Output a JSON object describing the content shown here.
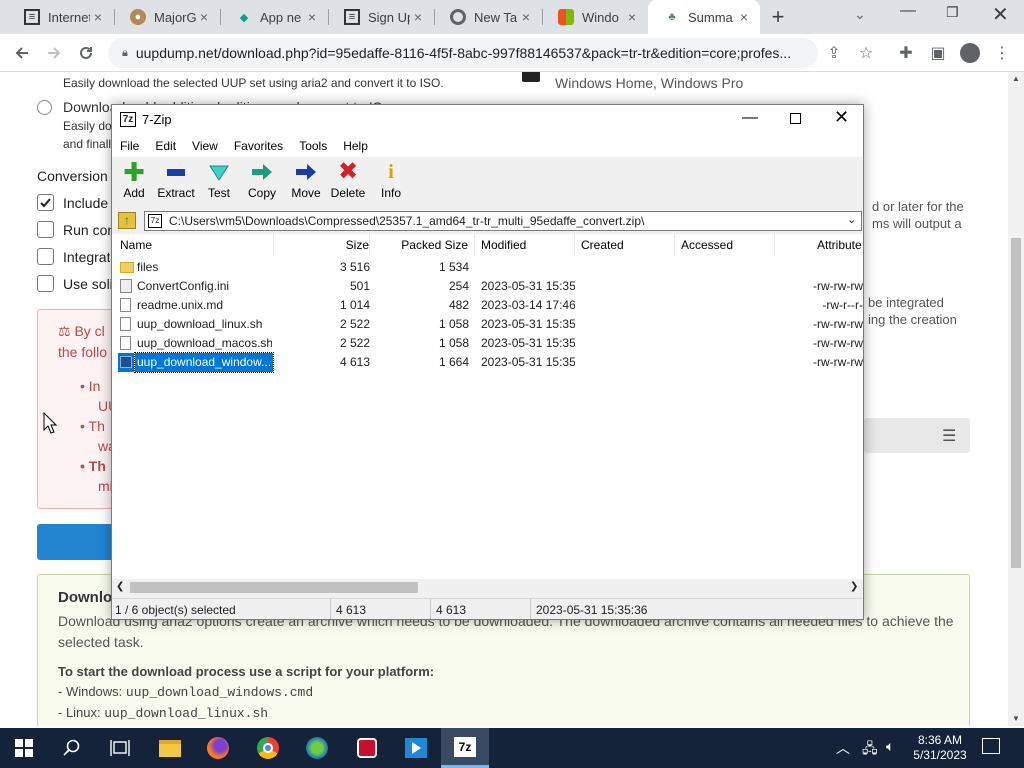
{
  "browser": {
    "tabs": [
      {
        "label": "Internet"
      },
      {
        "label": "MajorGe"
      },
      {
        "label": "App ne"
      },
      {
        "label": "Sign Up"
      },
      {
        "label": "New Tab"
      },
      {
        "label": "Windo"
      },
      {
        "label": "Summa"
      }
    ],
    "url": "uupdump.net/download.php?id=95edaffe-8116-4f5f-8abc-997f88146537&pack=tr-tr&edition=core;profes..."
  },
  "page": {
    "aria2_desc": "Easily download the selected UUP set using aria2 and convert it to ISO.",
    "option2_label": "Download, add additional editions and convert to ISO",
    "option2_desc1": "Easily dow",
    "option2_desc2": "and finally",
    "editions_text": "Windows Home, Windows Pro",
    "conversion_heading": "Conversion o",
    "opt_include": "Include",
    "opt_run": "Run con",
    "opt_integrate": "Integrat",
    "opt_use": "Use soli",
    "right_text1": "d or later for the",
    "right_text2": "ms will output a",
    "right_text3": "be integrated",
    "right_text4": "ing the creation",
    "warn_lead": "By cl",
    "warn_lead2": "the follo",
    "bullet1a": "In",
    "bullet1b": "UU",
    "bullet2a": "Th",
    "bullet2b": "wa",
    "bullet3a": "Th",
    "bullet3b": "mi",
    "download_heading": "Downlo",
    "download_desc1": "Download using aria2 options create an archive which needs to be downloaded. The downloaded archive contains all needed files to achieve the",
    "download_desc2": "selected task.",
    "script_heading": "To start the download process use a script for your platform:",
    "script_windows_label": "- Windows: ",
    "script_windows_file": "uup_download_windows.cmd",
    "script_linux_label": "- Linux: ",
    "script_linux_file": "uup_download_linux.sh"
  },
  "sevenzip": {
    "title": "7-Zip",
    "menu": [
      "File",
      "Edit",
      "View",
      "Favorites",
      "Tools",
      "Help"
    ],
    "tools": [
      "Add",
      "Extract",
      "Test",
      "Copy",
      "Move",
      "Delete",
      "Info"
    ],
    "path": "C:\\Users\\vm5\\Downloads\\Compressed\\25357.1_amd64_tr-tr_multi_95edaffe_convert.zip\\",
    "columns": [
      "Name",
      "Size",
      "Packed Size",
      "Modified",
      "Created",
      "Accessed",
      "Attribute"
    ],
    "files": [
      {
        "name": "files",
        "size": "3 516",
        "packed": "1 534",
        "modified": "",
        "attr": ""
      },
      {
        "name": "ConvertConfig.ini",
        "size": "501",
        "packed": "254",
        "modified": "2023-05-31 15:35",
        "attr": "-rw-rw-rw"
      },
      {
        "name": "readme.unix.md",
        "size": "1 014",
        "packed": "482",
        "modified": "2023-03-14 17:46",
        "attr": "-rw-r--r-"
      },
      {
        "name": "uup_download_linux.sh",
        "size": "2 522",
        "packed": "1 058",
        "modified": "2023-05-31 15:35",
        "attr": "-rw-rw-rw"
      },
      {
        "name": "uup_download_macos.sh",
        "size": "2 522",
        "packed": "1 058",
        "modified": "2023-05-31 15:35",
        "attr": "-rw-rw-rw"
      },
      {
        "name": "uup_download_window...",
        "size": "4 613",
        "packed": "1 664",
        "modified": "2023-05-31 15:35",
        "attr": "-rw-rw-rw"
      }
    ],
    "status": {
      "selected": "1 / 6 object(s) selected",
      "size": "4 613",
      "packed": "4 613",
      "modified": "2023-05-31 15:35:36"
    }
  },
  "taskbar": {
    "time": "8:36 AM",
    "date": "5/31/2023"
  },
  "colors": {
    "accent": "#1a73e8",
    "selection": "#0078d7",
    "taskbar": "#14233a"
  }
}
